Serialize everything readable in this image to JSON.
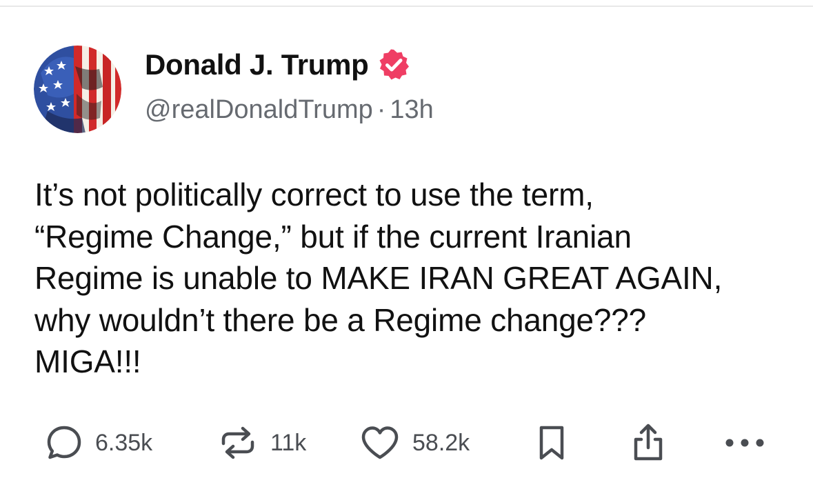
{
  "post": {
    "author": {
      "display_name": "Donald J. Trump",
      "handle": "@realDonaldTrump",
      "time_ago": "13h",
      "separator": "·",
      "verified": true
    },
    "body_lines": [
      "It’s not politically correct to use the term,",
      "“Regime Change,” but if the current Iranian",
      "Regime is unable to MAKE IRAN GREAT AGAIN,",
      "why wouldn’t there be a Regime change???",
      "MIGA!!!"
    ],
    "actions": {
      "replies": "6.35k",
      "reposts": "11k",
      "likes": "58.2k"
    }
  },
  "icons": {
    "reply": "comment-bubble-icon",
    "repost": "repost-arrows-icon",
    "like": "heart-icon",
    "bookmark": "bookmark-icon",
    "share": "share-icon",
    "more": "more-dots-icon",
    "verified": "verified-badge-icon"
  },
  "colors": {
    "verified_badge": "#ef3e64",
    "text_primary": "#111111",
    "text_secondary": "#666a70",
    "icon_gray": "#4a4d52"
  }
}
